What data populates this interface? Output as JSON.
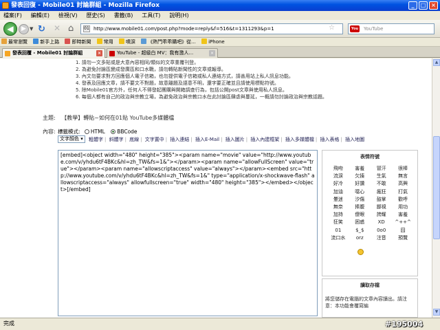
{
  "window": {
    "title": "發表回復 - Mobile01 討論群組 - Mozilla Firefox",
    "minimize": "_",
    "maximize": "□",
    "close": "×"
  },
  "menu": [
    "檔案(F)",
    "編輯(E)",
    "檢視(V)",
    "歷史(S)",
    "書籤(B)",
    "工具(T)",
    "說明(H)"
  ],
  "nav": {
    "url": "http://www.mobile01.com/post.php?mode=reply&f=516&t=1311293&p=1",
    "search_placeholder": "YouTube"
  },
  "bookmarks": [
    {
      "label": "最常瀏覽",
      "color": "#e6a23c"
    },
    {
      "label": "新手上路",
      "color": "#3d8bd9"
    },
    {
      "label": "即時新聞",
      "color": "#d9534f"
    },
    {
      "label": "常用",
      "color": "#f0c419"
    },
    {
      "label": "噴淚",
      "color": "#f0c419"
    },
    {
      "label": "《熱門乖乖購吧》從...",
      "color": "#5b9bd5"
    },
    {
      "label": "iPhone",
      "color": "#f0c419"
    }
  ],
  "tabs": [
    {
      "label": "發表回覆 - Mobile01 討論群組",
      "icon_color": "#f6a623"
    },
    {
      "label": "YouTube - 超級白 MV：我有激人...",
      "icon_color": "#cc0000"
    }
  ],
  "rules": [
    "1. 請勿一文多貼或是大意內容相同/類似的文章重覆刊登。",
    "2. 為避免討論區變成發廣區和口水戰，請勿轉貼新聞性的文章或報導。",
    "3. 內文勿要求對方回應個人電子信箱，也勿提供電子信箱或私人連絡方式，請善用站上私人訊息功能。",
    "4. 發表及回應文章，請不要文不對題，故意離題及語意不明，還字要正確並且請使用標點符號。",
    "5. 除Mobile01官方外，任何人不得發起團購與開箱調查行為，包括公開post文章與使用私人訊息。",
    "6. 每個人都有自己的政治與宗教立場，為避免政治與宗教口水在此討論區肆虐與蔓延，一概請勿討論政治與宗教話題。"
  ],
  "subject": {
    "label": "主題:",
    "value": "【教學】轉貼~如何在01貼 YouTube多媒體檔"
  },
  "content_label": "內容:",
  "mode": {
    "label": "標籤模式:",
    "html": "HTML",
    "bbcode": "BBCode"
  },
  "toolbar": {
    "color_select": "文字顏色",
    "items": [
      "粗體字",
      "斜體字",
      "底線",
      "文字置中",
      "插入連結",
      "插入E-Mail",
      "插入圖片",
      "插入內建框架",
      "插入多媒體檔",
      "插入表格",
      "插入地圖"
    ]
  },
  "editor_text": "[embed]<object width=\"480\" height=\"385\"><param name=\"movie\" value=\"http://www.youtube.com/v/yhdu6tF4BKc&hl=zh_TW&fs=1&\"></param><param name=\"allowFullScreen\" value=\"true\"></param><param name=\"allowscriptaccess\" value=\"always\"></param><embed src=\"http://www.youtube.com/v/yhdu6tF4BKc&hl=zh_TW&fs=1&\" type=\"application/x-shockwave-flash\" allowscriptaccess=\"always\" allowfullscreen=\"true\" width=\"480\" height=\"385\"></embed></object>[/embed]",
  "emoticons": {
    "title": "表情符號",
    "rows": [
      [
        "飛吻",
        "害羞",
        "冒汗",
        "很棒"
      ],
      [
        "流淚",
        "欠揍",
        "生氣",
        "無言"
      ],
      [
        "好冷",
        "好讚",
        "不敢",
        "高興"
      ],
      [
        "加油",
        "噁心",
        "瘋狂",
        "打氣"
      ],
      [
        "暈迷",
        "汐傷",
        "鼓掌",
        "歡呼"
      ],
      [
        "無奈",
        "捧腹",
        "鄙視",
        "用功"
      ],
      [
        "加持",
        "傻眼",
        "誇耀",
        "害羞"
      ],
      [
        "狂笑",
        "困惑",
        "XD",
        "^++^"
      ],
      [
        "01",
        "$_$",
        "0o0",
        "囧"
      ],
      [
        "流口水",
        "orz",
        "注音",
        "預覽"
      ]
    ]
  },
  "draft": {
    "title": "讀取存檔",
    "text": "將您儲存在電腦的文章內容讀出。請注意：本功能會覆寫編"
  },
  "status": "完成",
  "watermark": "#195004"
}
